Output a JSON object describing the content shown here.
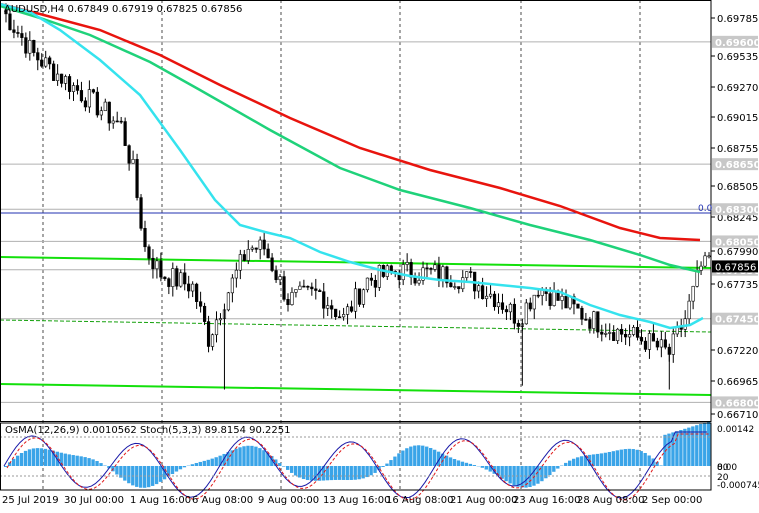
{
  "header": {
    "symbol_info": "AUDUSD,H4  0.67849 0.67919 0.67825 0.67856",
    "indicator_info": "OsMA(12,26,9) 0.0010562  Stoch(5,3,3) 89.8154 90.2251"
  },
  "price_axis": [
    "0.69785",
    "0.69535",
    "0.69270",
    "0.69015",
    "0.68755",
    "0.68505",
    "0.68245",
    "0.67990",
    "0.67735",
    "0.67220",
    "0.66965",
    "0.66710"
  ],
  "highlighted_levels": [
    {
      "label": "0.69600",
      "value": 0.696
    },
    {
      "label": "0.68650",
      "value": 0.6865
    },
    {
      "label": "0.68300",
      "value": 0.683
    },
    {
      "label": "0.68050",
      "value": 0.6805
    },
    {
      "label": "0.67830",
      "value": 0.6783
    },
    {
      "label": "0.67450",
      "value": 0.6745
    },
    {
      "label": "0.66800",
      "value": 0.668
    }
  ],
  "current_price": {
    "label": "0.67856",
    "value": 0.67856
  },
  "level_tag": "0.0",
  "sub_axis": [
    "0.00142",
    "80",
    "0.00",
    "20",
    "-0.000745"
  ],
  "time_axis": [
    "25 Jul 2019",
    "30 Jul 00:00",
    "1 Aug 16:00",
    "6 Aug 08:00",
    "9 Aug 00:00",
    "13 Aug 16:00",
    "16 Aug 08:00",
    "21 Aug 00:00",
    "23 Aug 16:00",
    "28 Aug 08:00",
    "2 Sep 00:00"
  ],
  "colors": {
    "background": "#ffffff",
    "bull_candle": "#000000",
    "bear_candle": "#000000",
    "ema_red": "#e8140e",
    "ema_green": "#1fd27a",
    "ema_cyan": "#35e3ee",
    "trend_line": "#13e00b",
    "blue_level": "#2030b0",
    "histogram": "#3aa4e8",
    "stoch_main": "#1a1aa8",
    "stoch_signal": "#e01818"
  }
}
